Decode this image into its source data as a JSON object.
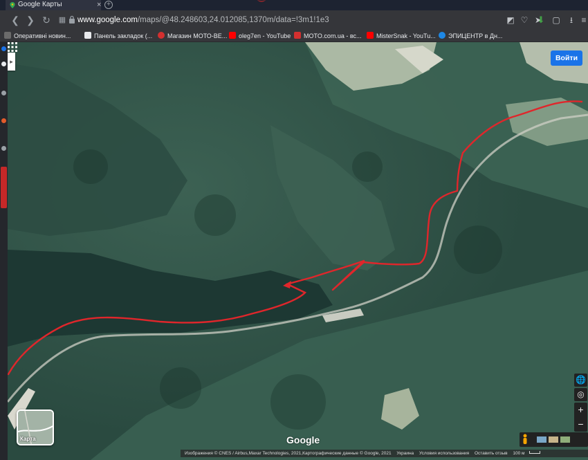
{
  "browser": {
    "tab_title": "Google Карты",
    "tab_close": "×",
    "new_tab": "+",
    "address_host": "www.google.com",
    "address_path": "/maps/@48.248603,24.012085,1370m/data=!3m1!1e3",
    "nav_icons": [
      "back-icon",
      "forward-icon",
      "reload-icon",
      "tab-grid-icon",
      "lock-icon"
    ],
    "toolbar_icons": [
      "camera-icon",
      "heart-icon",
      "send-icon",
      "download-green-icon",
      "cube-icon",
      "download-icon",
      "menu-icon"
    ]
  },
  "bookmarks": [
    {
      "label": "Оперативні новин...",
      "icon": "uni-news-icon",
      "color": "#8a8a8a"
    },
    {
      "label": "Панель закладок (...",
      "icon": "folder-icon",
      "color": "#ffffff"
    },
    {
      "label": "Магазин МОТО-ВЕ...",
      "icon": "moto-icon",
      "color": "#e53935"
    },
    {
      "label": "oleg7en - YouTube",
      "icon": "youtube-icon",
      "color": "#ff0000"
    },
    {
      "label": "MOTO.com.ua - вс...",
      "icon": "moto-com-icon",
      "color": "#e53935"
    },
    {
      "label": "MisterSnak - YouTu...",
      "icon": "youtube-icon",
      "color": "#ff0000"
    },
    {
      "label": "ЭПИЦЕНТР в Дн...",
      "icon": "epicentr-icon",
      "color": "#1e88e5"
    }
  ],
  "map": {
    "type": "satellite",
    "sign_in_label": "Войти",
    "layers_label": "Карта",
    "zoom_in": "+",
    "zoom_out": "−",
    "logo_text": "Google",
    "attribution": {
      "imagery": "Изображения © CNES / Airbus,Maxar Technologies, 2021,Картографические данные © Google, 2021",
      "country": "Украина",
      "terms": "Условия использования",
      "feedback": "Оставить отзыв",
      "scale": "100 м"
    },
    "route_color": "#e0262b",
    "colors": {
      "forest_dark": "#1f3a36",
      "forest": "#345a4c",
      "meadow": "#a9b9a1",
      "road": "#cfcfc5"
    }
  }
}
